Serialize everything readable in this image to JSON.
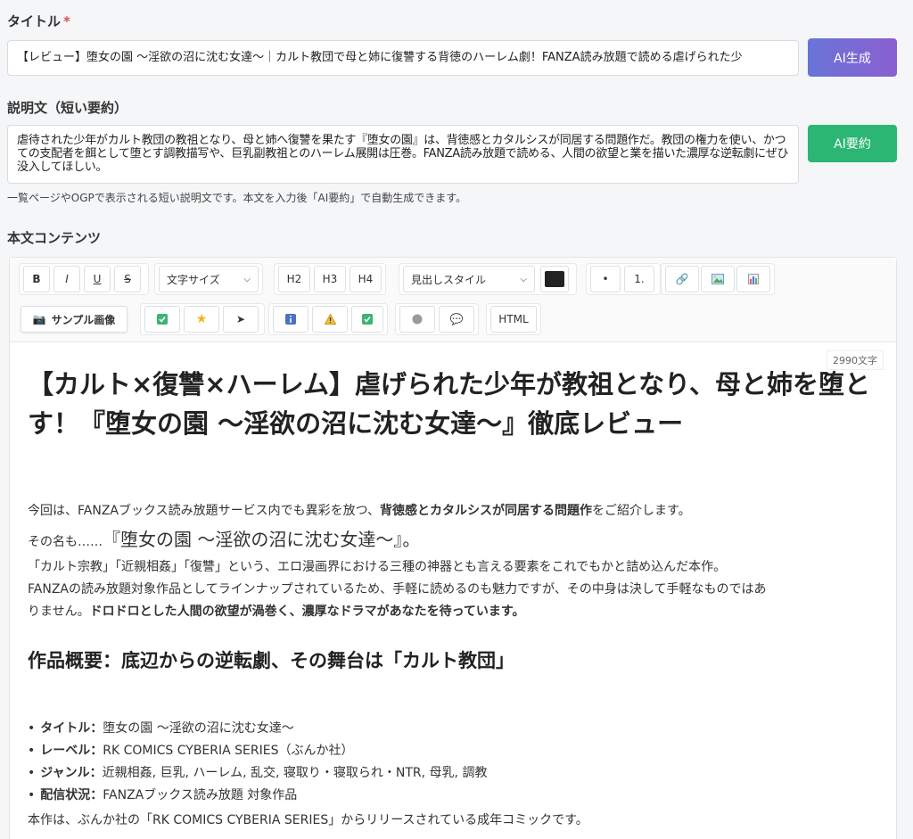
{
  "title_field": {
    "label": "タイトル",
    "required_mark": "*",
    "value": "【レビュー】堕女の園 〜淫欲の沼に沈む女達〜｜カルト教団で母と姉に復讐する背徳のハーレム劇！FANZA読み放題で読める虐げられた少"
  },
  "ai_generate_button": "AI生成",
  "summary_field": {
    "label": "説明文（短い要約）",
    "value": "虐待された少年がカルト教団の教祖となり、母と姉へ復讐を果たす『堕女の園』は、背徳感とカタルシスが同居する問題作だ。教団の権力を使い、かつての支配者を餌として堕とす調教描写や、巨乳副教祖とのハーレム展開は圧巻。FANZA読み放題で読める、人間の欲望と業を描いた濃厚な逆転劇にぜひ没入してほしい。",
    "hint": "一覧ページやOGPで表示される短い説明文です。本文を入力後「AI要約」で自動生成できます。"
  },
  "ai_summary_button": "AI要約",
  "content_label": "本文コンテンツ",
  "toolbar": {
    "bold": "B",
    "italic": "I",
    "underline": "U",
    "strike": "S",
    "font_size": "文字サイズ",
    "h2": "H2",
    "h3": "H3",
    "h4": "H4",
    "heading_style": "見出しスタイル",
    "text_color": "#222222",
    "bullet": "•",
    "numbered": "1.",
    "sample_image": "サンプル画像",
    "html": "HTML"
  },
  "char_count": "2990文字",
  "article": {
    "h1": "【カルト×復讐×ハーレム】虐げられた少年が教祖となり、母と姉を堕とす！『堕女の園 〜淫欲の沼に沈む女達〜』徹底レビュー",
    "p1_a": "今回は、FANZAブックス読み放題サービス内でも異彩を放つ、",
    "p1_b": "背徳感とカタルシスが同居する問題作",
    "p1_c": "をご紹介します。",
    "p2_a": "その名も……",
    "p2_b": "『堕女の園 〜淫欲の沼に沈む女達〜』。",
    "p3": "「カルト宗教」「近親相姦」「復讐」という、エロ漫画界における三種の神器とも言える要素をこれでもかと詰め込んだ本作。",
    "p4": "FANZAの読み放題対象作品としてラインナップされているため、手軽に読めるのも魅力ですが、その中身は決して手軽なものではあ",
    "p5_a": "りません。",
    "p5_b": "ドロドロとした人間の欲望が渦巻く、濃厚なドラマがあなたを待っています。",
    "h2": "作品概要：底辺からの逆転劇、その舞台は「カルト教団」",
    "info": [
      {
        "key": "タイトル：",
        "value": "堕女の園 〜淫欲の沼に沈む女達〜"
      },
      {
        "key": "レーベル：",
        "value": "RK COMICS CYBERIA SERIES（ぶんか社）"
      },
      {
        "key": "ジャンル：",
        "value": "近親相姦, 巨乳, ハーレム, 乱交, 寝取り・寝取られ・NTR, 母乳, 調教"
      },
      {
        "key": "配信状況：",
        "value": "FANZAブックス読み放題 対象作品"
      }
    ],
    "p6": "本作は、ぶんか社の「RK COMICS CYBERIA SERIES」からリリースされている成年コミックです。"
  }
}
